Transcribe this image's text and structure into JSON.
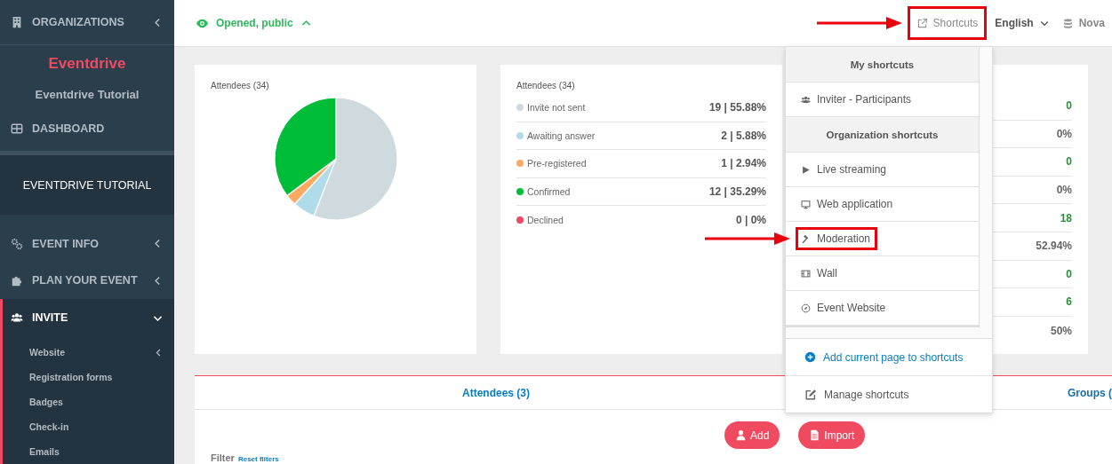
{
  "sidebar": {
    "organizations": {
      "label": "ORGANIZATIONS",
      "expanded": false
    },
    "brand": "Eventdrive",
    "org_name": "Eventdrive Tutorial",
    "dashboard": {
      "label": "DASHBOARD"
    },
    "event_title": "EVENTDRIVE TUTORIAL",
    "menu": [
      {
        "label": "EVENT INFO",
        "expanded": false,
        "selected": false
      },
      {
        "label": "PLAN YOUR EVENT",
        "expanded": false,
        "selected": false
      },
      {
        "label": "INVITE",
        "expanded": true,
        "selected": true,
        "children": [
          {
            "label": "Website",
            "kind": "submenu"
          },
          {
            "label": "Registration forms",
            "kind": "link"
          },
          {
            "label": "Badges",
            "kind": "link"
          },
          {
            "label": "Check-in",
            "kind": "link"
          },
          {
            "label": "Emails",
            "kind": "link"
          }
        ]
      }
    ]
  },
  "topbar": {
    "status": {
      "label": "Opened, public",
      "expanded": true
    },
    "shortcuts": {
      "label": "Shortcuts",
      "highlighted": true
    },
    "language": "English",
    "instance": "Nova"
  },
  "cards": {
    "chart_card": {
      "title": "Attendees (34)"
    },
    "legend_card": {
      "title": "Attendees (34)",
      "rows": [
        {
          "label": "Invite not sent",
          "value": "19 | 55.88%",
          "color": "#cfdadf"
        },
        {
          "label": "Awaiting answer",
          "value": "2 | 5.88%",
          "color": "#b0dcea"
        },
        {
          "label": "Pre-registered",
          "value": "1 | 2.94%",
          "color": "#fca964"
        },
        {
          "label": "Confirmed",
          "value": "12 | 35.29%",
          "color": "#00bd39"
        },
        {
          "label": "Declined",
          "value": "0 | 0%",
          "color": "#f04a60"
        }
      ]
    },
    "stats_card": {
      "rows": [
        {
          "value": "0",
          "kind": "count"
        },
        {
          "value": "0%",
          "kind": "percent"
        },
        {
          "value": "0",
          "kind": "count"
        },
        {
          "value": "0%",
          "kind": "percent"
        },
        {
          "value": "18",
          "kind": "count"
        },
        {
          "value": "52.94%",
          "kind": "percent"
        },
        {
          "value": "0",
          "kind": "count"
        },
        {
          "value": "6",
          "kind": "count"
        },
        {
          "value": "50%",
          "kind": "percent"
        }
      ]
    }
  },
  "tabs": [
    {
      "label": "Attendees (3)",
      "selected": true
    },
    {
      "label": "Groups (",
      "selected": false
    }
  ],
  "actions": [
    {
      "label": "Add"
    },
    {
      "label": "Import"
    }
  ],
  "filter": {
    "label": "Filter",
    "link": "Reset filters"
  },
  "shortcuts_menu": {
    "sections": [
      {
        "title": "My shortcuts",
        "items": [
          {
            "label": "Inviter - Participants",
            "highlighted": false
          }
        ]
      },
      {
        "title": "Organization shortcuts",
        "items": [
          {
            "label": "Live streaming",
            "highlighted": false
          },
          {
            "label": "Web application",
            "highlighted": false
          },
          {
            "label": "Moderation",
            "highlighted": true
          },
          {
            "label": "Wall",
            "highlighted": false
          },
          {
            "label": "Event Website",
            "highlighted": false
          }
        ]
      }
    ],
    "footer": [
      {
        "label": "Add current page to shortcuts",
        "kind": "add"
      },
      {
        "label": "Manage shortcuts",
        "kind": "manage"
      }
    ]
  }
}
